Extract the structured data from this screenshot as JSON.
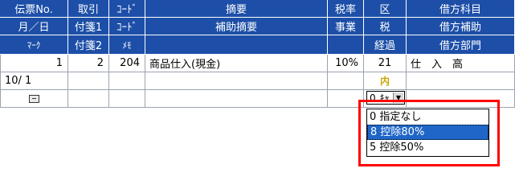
{
  "header": {
    "row1": [
      "伝票No.",
      "取引",
      "ｺｰﾄﾞ",
      "摘要",
      "税率",
      "区",
      "借方科目"
    ],
    "row2": [
      "月／日",
      "付箋1",
      "ｺｰﾄﾞ",
      "補助摘要",
      "事業",
      "税",
      "借方補助"
    ],
    "row3": [
      "ﾏｰｸ",
      "付箋2",
      "ﾒﾓ",
      "",
      "",
      "経過",
      "借方部門"
    ]
  },
  "entry": {
    "slip_no": "1",
    "transaction": "2",
    "code": "204",
    "summary": "商品仕入(現金)",
    "tax_rate": "10%",
    "category": "21",
    "debit_account": "仕　入　高",
    "date": "10/ 1",
    "tax_tag": "内",
    "mark_icon": "memo-icon"
  },
  "combo": {
    "value": "0",
    "text": "ｷｬ",
    "arrow_icon": "chevron-down-icon"
  },
  "dropdown": {
    "options": [
      {
        "label": "0 指定なし",
        "selected": false
      },
      {
        "label": "8 控除80%",
        "selected": true
      },
      {
        "label": "5 控除50%",
        "selected": false
      }
    ]
  },
  "colors": {
    "header_bg": "#1d4fa8",
    "selected_bg": "#1f66c8",
    "highlight": "#ff0000",
    "tax_tag": "#c8a600"
  }
}
